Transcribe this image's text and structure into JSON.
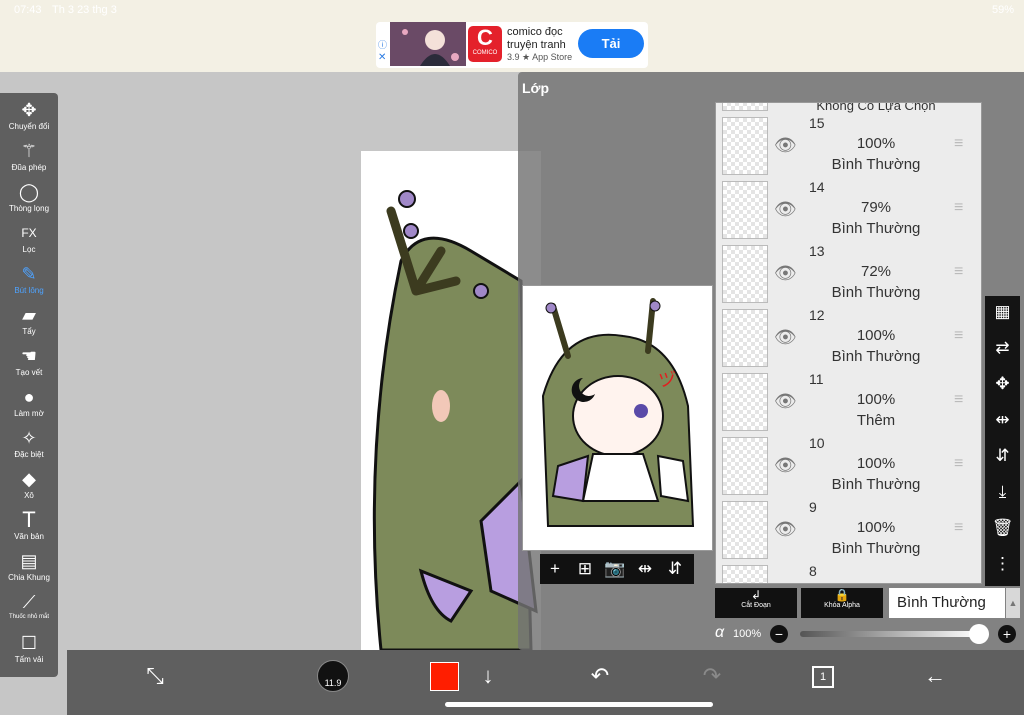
{
  "status": {
    "time": "07:43",
    "date": "Th 3 23 thg 3",
    "battery": "59%"
  },
  "ad": {
    "info_icon": "ⓘ",
    "close_icon": "✕",
    "logo_letter": "C",
    "logo_word": "COMICO",
    "title_line1": "comico đọc",
    "title_line2": "truyện tranh",
    "rating": "3.9 ★ App Store",
    "button": "Tải"
  },
  "tools": [
    {
      "label": "Chuyển đổi",
      "icon": "move-icon",
      "glyph": "✥"
    },
    {
      "label": "Đũa phép",
      "icon": "magic-wand-icon",
      "glyph": "⚚"
    },
    {
      "label": "Thòng lọng",
      "icon": "lasso-icon",
      "glyph": "◯"
    },
    {
      "label": "Lọc",
      "icon": "fx-icon",
      "glyph": "FX"
    },
    {
      "label": "Bút lông",
      "icon": "brush-icon",
      "glyph": "✎"
    },
    {
      "label": "Tẩy",
      "icon": "eraser-icon",
      "glyph": "▰"
    },
    {
      "label": "Tạo vết",
      "icon": "smudge-icon",
      "glyph": "☚"
    },
    {
      "label": "Làm mờ",
      "icon": "blur-icon",
      "glyph": "●"
    },
    {
      "label": "Đặc biệt",
      "icon": "special-icon",
      "glyph": "✧"
    },
    {
      "label": "Xô",
      "icon": "bucket-icon",
      "glyph": "◆"
    },
    {
      "label": "Văn bản",
      "icon": "text-icon",
      "glyph": "T"
    },
    {
      "label": "Chia Khung",
      "icon": "frame-divider-icon",
      "glyph": "▤"
    },
    {
      "label": "Thuốc nhỏ mắt",
      "icon": "eyedropper-icon",
      "glyph": "⟋"
    },
    {
      "label": "Tấm vải",
      "icon": "canvas-icon",
      "glyph": "☐"
    }
  ],
  "active_tool": "Bút lông",
  "bottombar": {
    "transform_glyph": "⤡",
    "brush_size": "11.9",
    "color": "#ff1e00",
    "down_glyph": "↓",
    "undo_glyph": "↶",
    "redo_glyph": "↷",
    "layers_count": "1",
    "back_glyph": "←"
  },
  "layers_panel": {
    "title": "Lớp",
    "top_partial_label": "Không Có Lựa Chọn",
    "layers": [
      {
        "number": "15",
        "opacity": "100%",
        "blend": "Bình Thường"
      },
      {
        "number": "14",
        "opacity": "79%",
        "blend": "Bình Thường"
      },
      {
        "number": "13",
        "opacity": "72%",
        "blend": "Bình Thường"
      },
      {
        "number": "12",
        "opacity": "100%",
        "blend": "Bình Thường"
      },
      {
        "number": "11",
        "opacity": "100%",
        "blend": "Thêm"
      },
      {
        "number": "10",
        "opacity": "100%",
        "blend": "Bình Thường"
      },
      {
        "number": "9",
        "opacity": "100%",
        "blend": "Bình Thường"
      },
      {
        "number": "8",
        "opacity": "",
        "blend": ""
      }
    ],
    "eye_glyph": "👁",
    "grip_glyph": "≡",
    "preview_tools": [
      "+",
      "⊞",
      "📷",
      "⇹",
      "⇵"
    ],
    "side_tools": [
      {
        "icon": "checker-icon",
        "glyph": "▦"
      },
      {
        "icon": "layer-transfer-icon",
        "glyph": "⇄"
      },
      {
        "icon": "move-layer-icon",
        "glyph": "✥"
      },
      {
        "icon": "flip-horizontal-icon",
        "glyph": "⇹"
      },
      {
        "icon": "flip-vertical-icon",
        "glyph": "⇵"
      },
      {
        "icon": "merge-down-icon",
        "glyph": "⤓"
      },
      {
        "icon": "trash-icon",
        "glyph": "🗑"
      },
      {
        "icon": "more-icon",
        "glyph": "⋮"
      }
    ],
    "clip_label": "Cắt Đoạn",
    "clip_glyph": "↲",
    "alpha_lock_label": "Khóa Alpha",
    "alpha_lock_glyph": "🔒",
    "blend_mode": "Bình Thường",
    "blend_arrow": "▲",
    "alpha_symbol": "α",
    "alpha_value": "100%",
    "alpha_level": 1.0,
    "minus_glyph": "−",
    "plus_glyph": "+"
  }
}
